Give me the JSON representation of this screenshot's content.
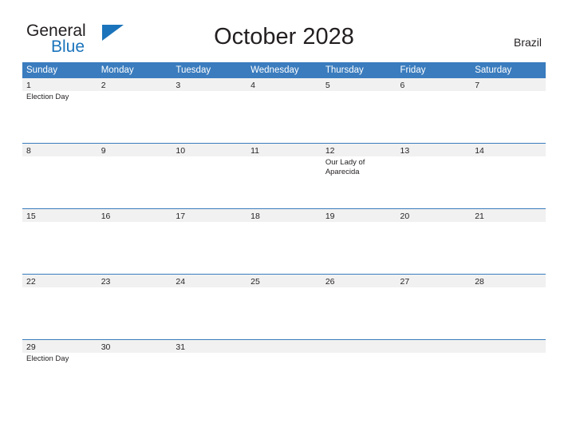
{
  "brand": {
    "name_top": "General",
    "name_bottom": "Blue",
    "triangle_icon": "triangle-icon",
    "accent_color": "#1b74bb"
  },
  "header": {
    "title": "October 2028",
    "country": "Brazil"
  },
  "calendar": {
    "header_bg": "#3a7cbe",
    "daynum_bg": "#f1f1f1",
    "weekdays": [
      "Sunday",
      "Monday",
      "Tuesday",
      "Wednesday",
      "Thursday",
      "Friday",
      "Saturday"
    ],
    "weeks": [
      [
        {
          "day": "1",
          "events": [
            "Election Day"
          ]
        },
        {
          "day": "2",
          "events": []
        },
        {
          "day": "3",
          "events": []
        },
        {
          "day": "4",
          "events": []
        },
        {
          "day": "5",
          "events": []
        },
        {
          "day": "6",
          "events": []
        },
        {
          "day": "7",
          "events": []
        }
      ],
      [
        {
          "day": "8",
          "events": []
        },
        {
          "day": "9",
          "events": []
        },
        {
          "day": "10",
          "events": []
        },
        {
          "day": "11",
          "events": []
        },
        {
          "day": "12",
          "events": [
            "Our Lady of Aparecida"
          ]
        },
        {
          "day": "13",
          "events": []
        },
        {
          "day": "14",
          "events": []
        }
      ],
      [
        {
          "day": "15",
          "events": []
        },
        {
          "day": "16",
          "events": []
        },
        {
          "day": "17",
          "events": []
        },
        {
          "day": "18",
          "events": []
        },
        {
          "day": "19",
          "events": []
        },
        {
          "day": "20",
          "events": []
        },
        {
          "day": "21",
          "events": []
        }
      ],
      [
        {
          "day": "22",
          "events": []
        },
        {
          "day": "23",
          "events": []
        },
        {
          "day": "24",
          "events": []
        },
        {
          "day": "25",
          "events": []
        },
        {
          "day": "26",
          "events": []
        },
        {
          "day": "27",
          "events": []
        },
        {
          "day": "28",
          "events": []
        }
      ],
      [
        {
          "day": "29",
          "events": [
            "Election Day"
          ]
        },
        {
          "day": "30",
          "events": []
        },
        {
          "day": "31",
          "events": []
        },
        {
          "day": "",
          "events": []
        },
        {
          "day": "",
          "events": []
        },
        {
          "day": "",
          "events": []
        },
        {
          "day": "",
          "events": []
        }
      ]
    ]
  }
}
